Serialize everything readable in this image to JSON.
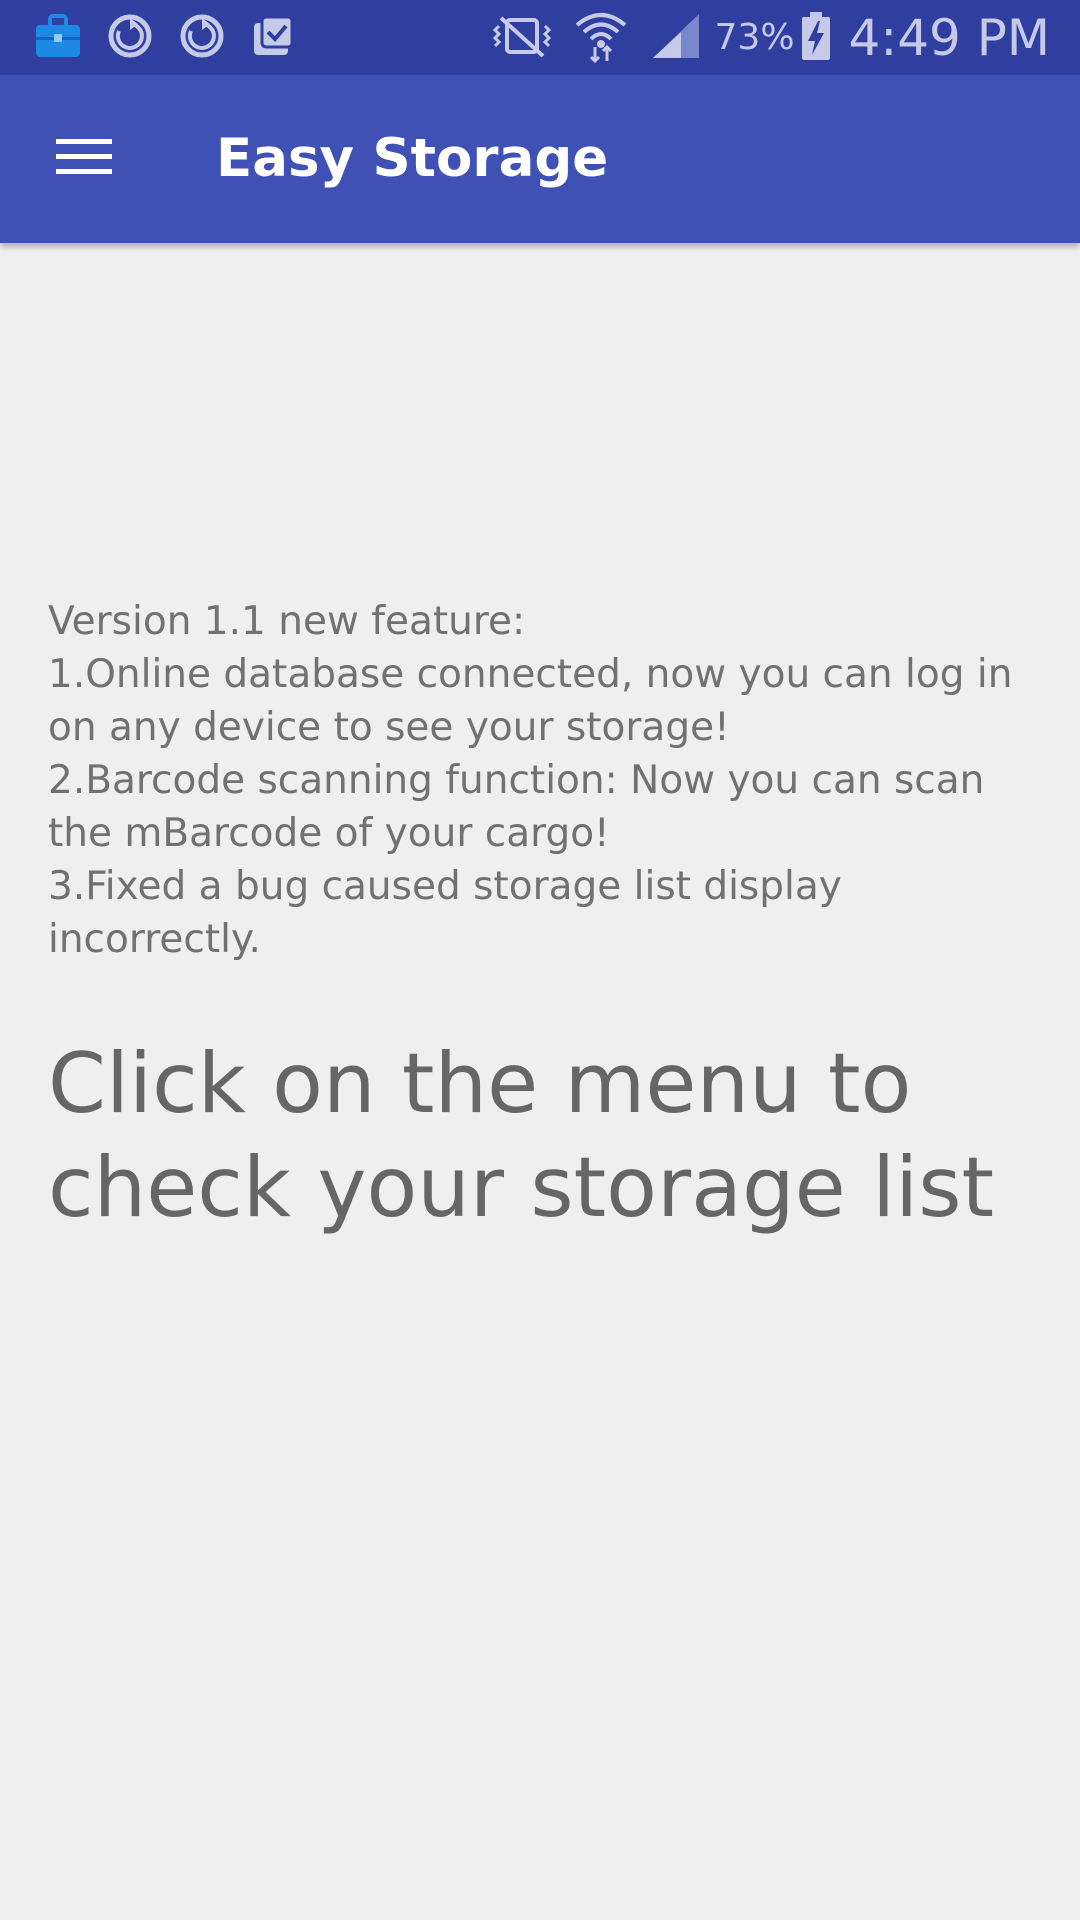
{
  "status_bar": {
    "left_icons": [
      "briefcase-icon",
      "sync-icon",
      "sync-icon",
      "clipboard-check-icon"
    ],
    "right_icons": [
      "vibrate-mute-icon",
      "wifi-icon",
      "signal-icon",
      "battery-charging-icon"
    ],
    "battery_percent": "73%",
    "time": "4:49 PM"
  },
  "app_bar": {
    "title": "Easy Storage",
    "menu_icon": "hamburger-menu-icon"
  },
  "main": {
    "feature_notes": [
      "Version 1.1 new feature:",
      "1.Online database connected, now you can log in",
      "on any device to see your storage!",
      "2.Barcode scanning function: Now you can scan",
      "the mBarcode of your cargo!",
      "3.Fixed a bug caused storage list display",
      "incorrectly."
    ],
    "instruction": [
      "Click on the menu to",
      "check your storage list"
    ]
  },
  "colors": {
    "status_bar": "#303f9f",
    "app_bar": "#3f51b5",
    "background": "#efefef",
    "text": "#717171"
  }
}
